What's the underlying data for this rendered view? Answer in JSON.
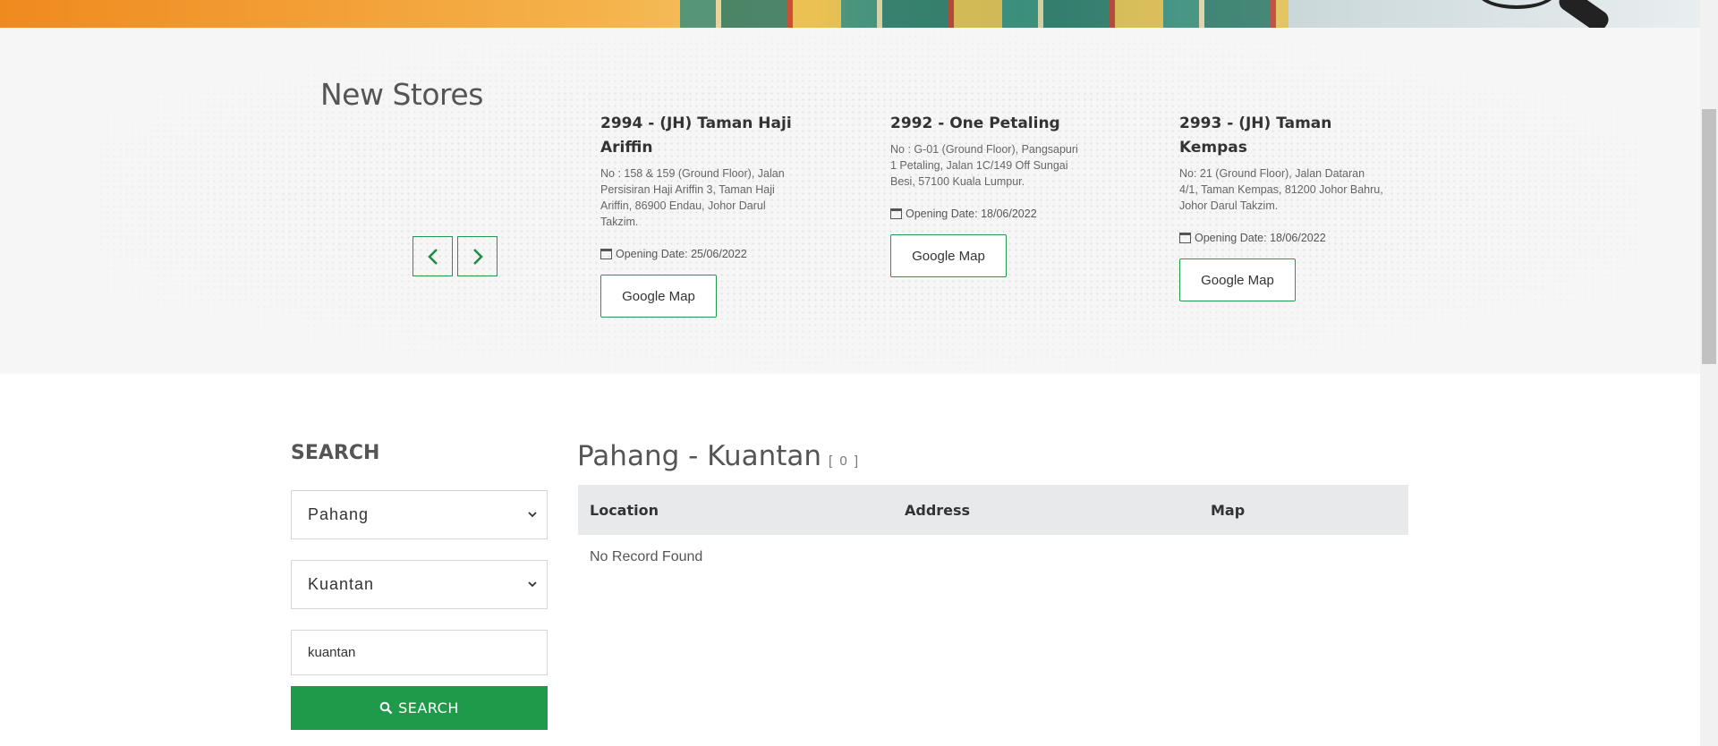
{
  "new_stores": {
    "heading": "New Stores",
    "stores": [
      {
        "title": "2994 - (JH) Taman Haji Ariffin",
        "address": "No : 158 & 159 (Ground Floor), Jalan Persisiran Haji Ariffin 3, Taman Haji Ariffin, 86900 Endau, Johor Darul Takzim.",
        "opening_date": "Opening Date: 25/06/2022",
        "map_label": "Google Map"
      },
      {
        "title": "2992 - One Petaling",
        "address": "No : G-01 (Ground Floor), Pangsapuri 1 Petaling, Jalan 1C/149 Off Sungai Besi, 57100 Kuala Lumpur.",
        "opening_date": "Opening Date: 18/06/2022",
        "map_label": "Google Map"
      },
      {
        "title": "2993 - (JH) Taman Kempas",
        "address": "No: 21 (Ground Floor), Jalan Dataran 4/1, Taman Kempas, 81200 Johor Bahru, Johor Darul Takzim.",
        "opening_date": "Opening Date: 18/06/2022",
        "map_label": "Google Map"
      }
    ]
  },
  "search": {
    "heading": "SEARCH",
    "state_value": "Pahang",
    "city_value": "Kuantan",
    "keyword_value": "kuantan",
    "button_label": "SEARCH"
  },
  "results": {
    "title": "Pahang - Kuantan",
    "count": "[ 0 ]",
    "columns": [
      "Location",
      "Address",
      "Map"
    ],
    "empty_message": "No Record Found"
  },
  "colors": {
    "accent_green": "#1f9a4a",
    "table_header_bg": "#e7e9ea",
    "section_bg": "#f6f6f6"
  }
}
